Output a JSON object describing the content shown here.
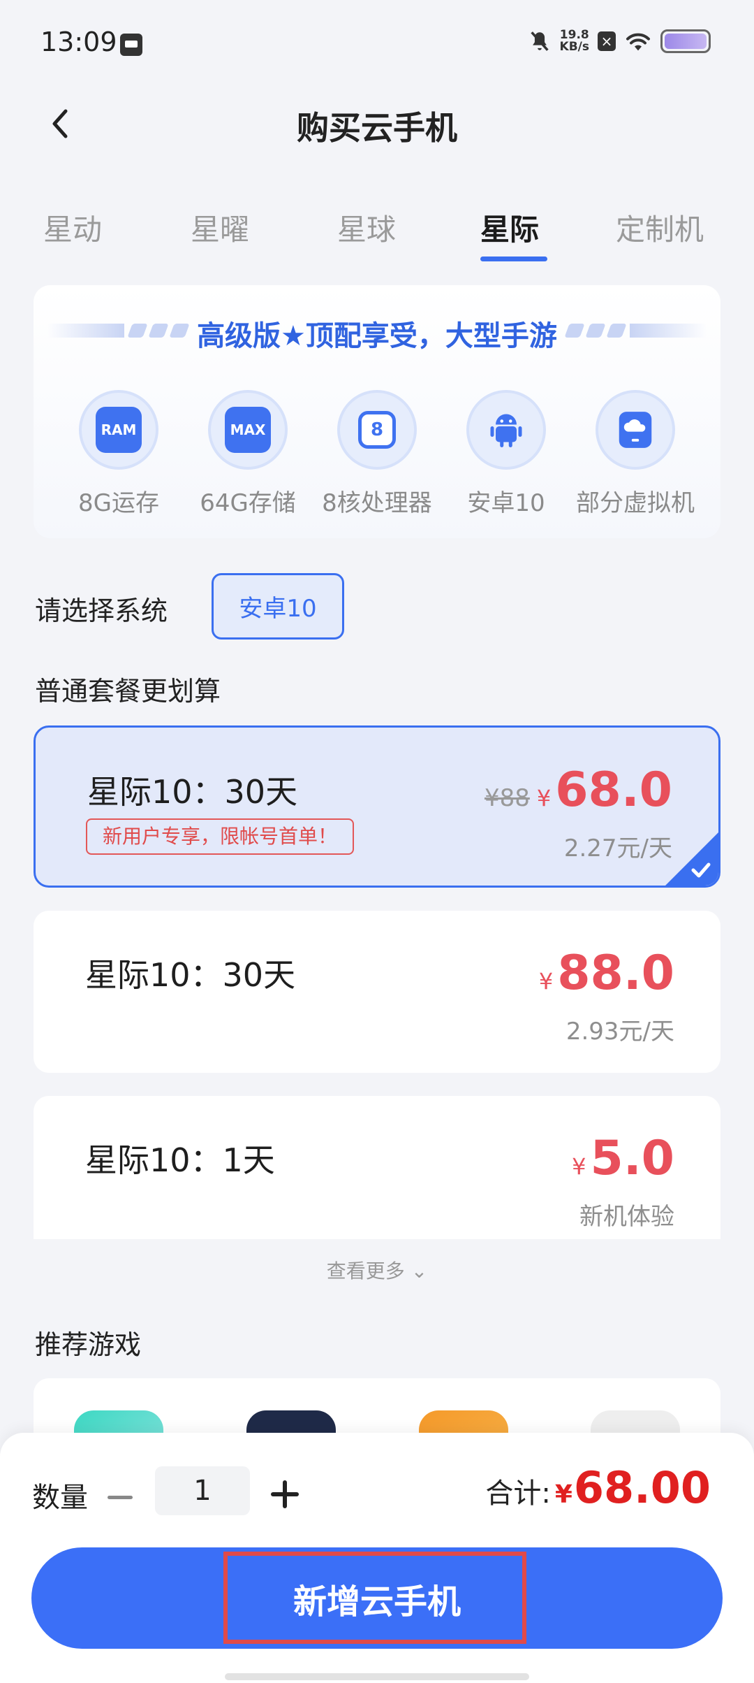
{
  "status_bar": {
    "time": "13:09",
    "speed_value": "19.8",
    "speed_unit": "KB/s"
  },
  "header": {
    "title": "购买云手机"
  },
  "tabs": [
    {
      "label": "星动"
    },
    {
      "label": "星曜"
    },
    {
      "label": "星球"
    },
    {
      "label": "星际"
    },
    {
      "label": "定制机"
    }
  ],
  "active_tab": "星际",
  "feature_card": {
    "title": "高级版★顶配享受，大型手游",
    "items": [
      {
        "label": "8G运存",
        "icon": "ram-icon",
        "icon_text": "RAM"
      },
      {
        "label": "64G存储",
        "icon": "sd-card-icon",
        "icon_text": "MAX"
      },
      {
        "label": "8核处理器",
        "icon": "cpu-icon",
        "icon_text": "8"
      },
      {
        "label": "安卓10",
        "icon": "android-icon",
        "icon_text": ""
      },
      {
        "label": "部分虚拟机",
        "icon": "cloud-phone-icon",
        "icon_text": ""
      }
    ]
  },
  "system": {
    "label": "请选择系统",
    "selected": "安卓10"
  },
  "plans_section": {
    "title": "普通套餐更划算"
  },
  "plans": [
    {
      "name": "星际10：30天",
      "tag": "新用户专享，限帐号首单！",
      "old_price": "¥88",
      "currency": "¥",
      "price": "68.0",
      "per_day": "2.27元/天",
      "selected": true
    },
    {
      "name": "星际10：30天",
      "tag": "",
      "old_price": "",
      "currency": "¥",
      "price": "88.0",
      "per_day": "2.93元/天",
      "selected": false
    },
    {
      "name": "星际10：1天",
      "tag": "",
      "old_price": "",
      "currency": "¥",
      "price": "5.0",
      "per_day": "新机体验",
      "selected": false
    }
  ],
  "view_more": "查看更多",
  "games_section": {
    "title": "推荐游戏"
  },
  "bottom_bar": {
    "quantity_label": "数量",
    "quantity": "1",
    "total_label": "合计:",
    "total_currency": "¥",
    "total_value": "68.00",
    "cta_label": "新增云手机"
  },
  "colors": {
    "accent": "#3a6ff0",
    "price": "#e8505b",
    "total": "#e02020"
  }
}
